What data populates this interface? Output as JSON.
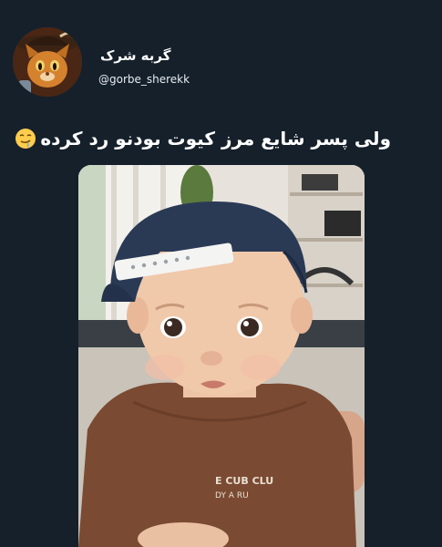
{
  "tweet": {
    "author_name": "گربه شرک",
    "author_handle": "@gorbe_sherekk",
    "text": "ولی پسر شایع مرز کیوت بودنو رد کرده",
    "emoji": "drooling-face-emoji",
    "avatar_icon": "puss-in-boots-cat-avatar"
  },
  "media": {
    "subject": "baby-in-backwards-cap-photo",
    "shirt_print_line1": "E CUB CLU",
    "shirt_print_line2": "DY   A  RU"
  },
  "colors": {
    "background": "#15202b",
    "text": "#ffffff",
    "cap": "#2a3a55",
    "shirt": "#7a4a32"
  }
}
